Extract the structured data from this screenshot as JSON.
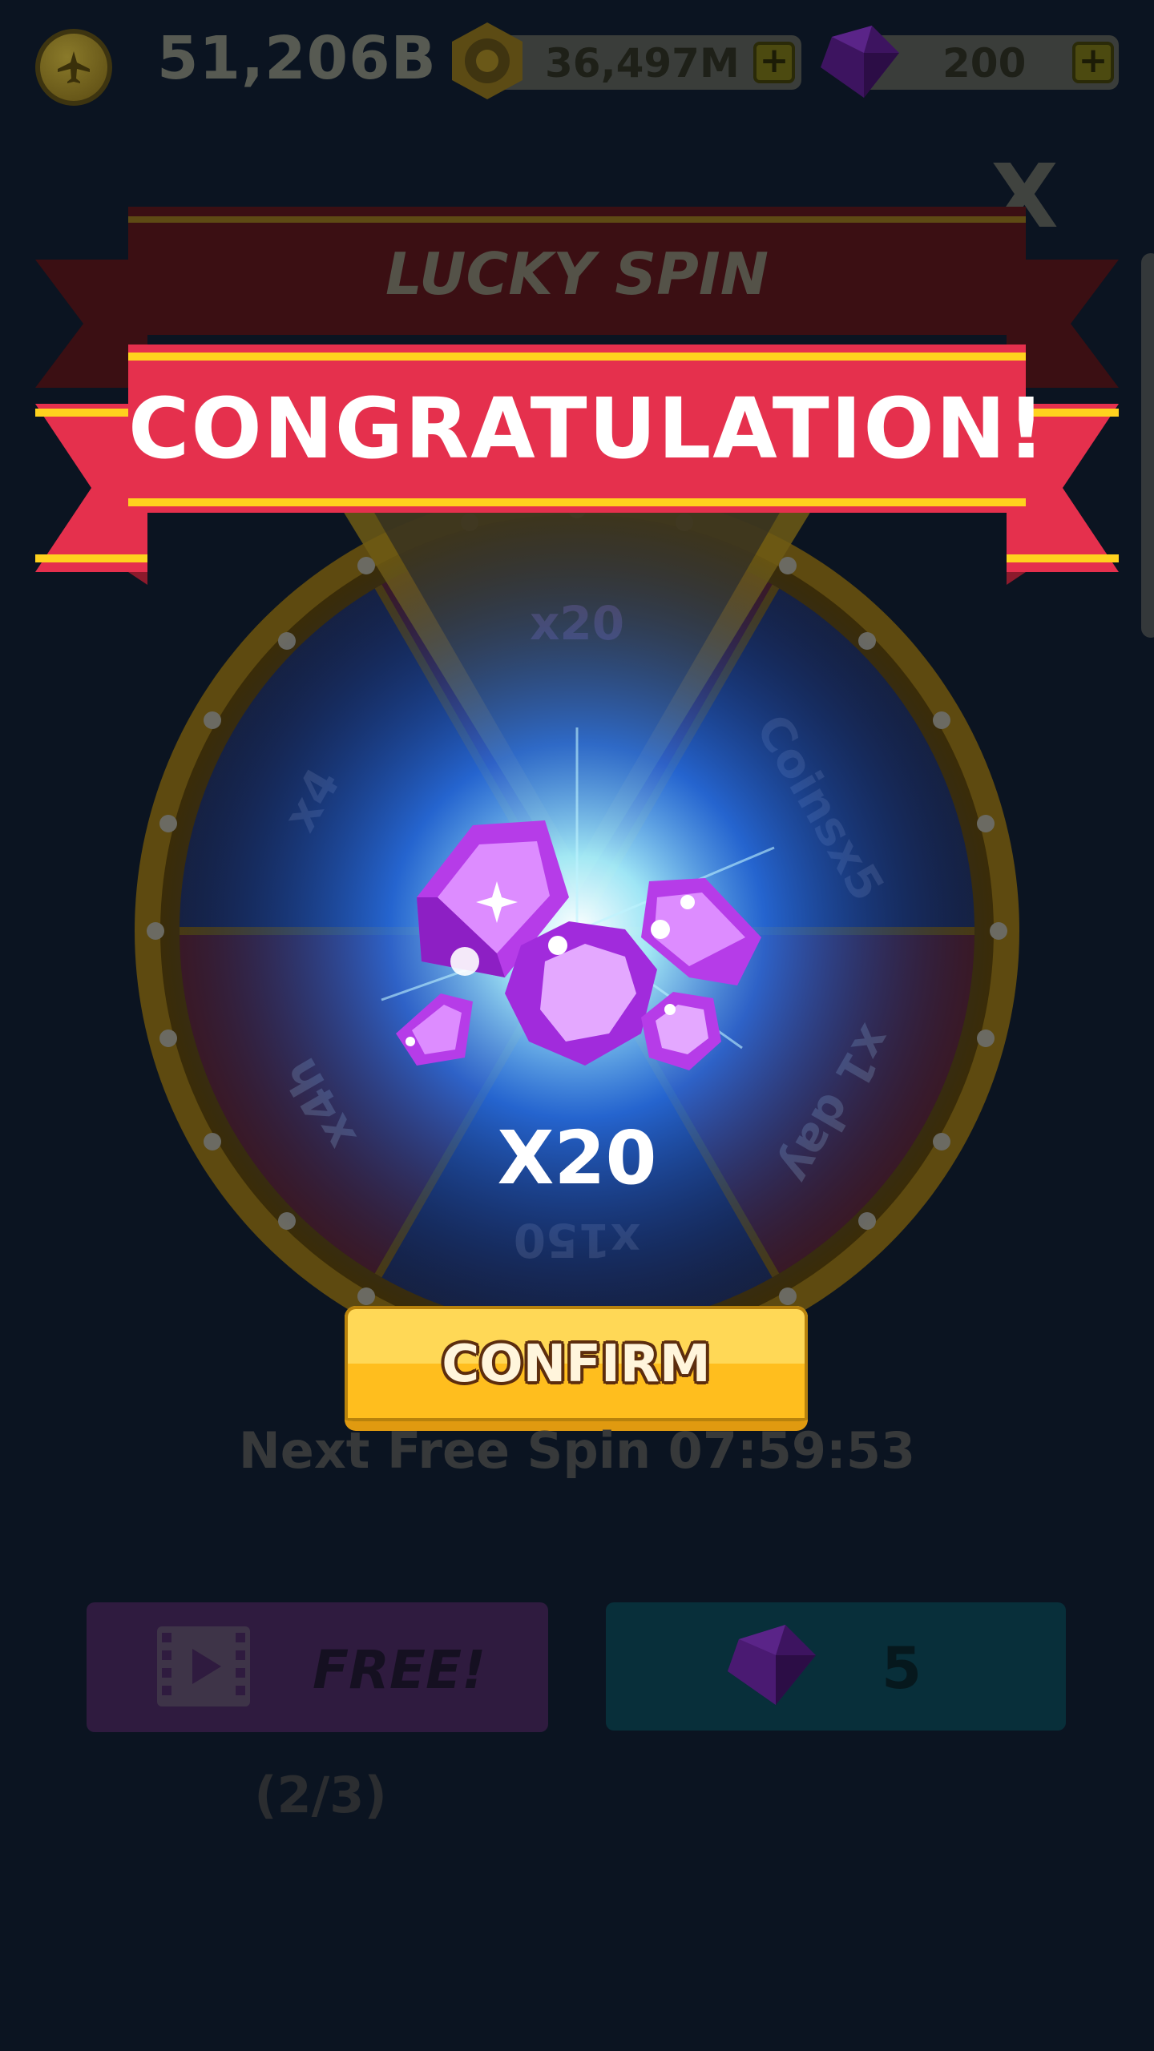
{
  "topbar": {
    "coins": "51,206B",
    "tokens": "36,497M",
    "gems": "200",
    "plus": "+"
  },
  "close_label": "X",
  "header": {
    "title": "LUCKY SPIN",
    "banner": "CONGRATULATION!"
  },
  "wheel": {
    "segments": [
      "x20",
      "Coinsx5",
      "x1 day",
      "x150",
      "x4h",
      "x4"
    ]
  },
  "prize": {
    "count": "X20",
    "icon": "gems-icon"
  },
  "confirm_label": "CONFIRM",
  "next_spin": "Next Free Spin 07:59:53",
  "free_button": {
    "label": "FREE!",
    "icon": "video-icon",
    "count": "(2/3)"
  },
  "gem_button": {
    "label": "5",
    "icon": "gem-icon"
  },
  "colors": {
    "background": "#0b1421",
    "banner_red": "#e5304d",
    "banner_gold": "#ffd21e",
    "confirm_yellow": "#ffbe1e",
    "gem_purple": "#b63ce8"
  }
}
